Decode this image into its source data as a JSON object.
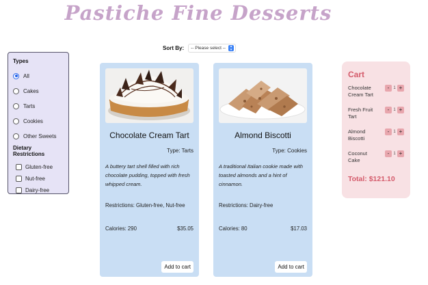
{
  "site": {
    "title": "Pastiche Fine Desserts"
  },
  "sort": {
    "label": "Sort By:",
    "selected": "-- Please select --"
  },
  "filters": {
    "types_heading": "Types",
    "types": [
      "All",
      "Cakes",
      "Tarts",
      "Cookies",
      "Other Sweets"
    ],
    "selected_type": "All",
    "dietary_heading": "Dietary Restrictions",
    "dietary": [
      "Gluten-free",
      "Nut-free",
      "Dairy-free"
    ]
  },
  "products": [
    {
      "name": "Chocolate Cream Tart",
      "type": "Type: Tarts",
      "description": "A buttery tart shell filled with rich chocolate pudding, topped with fresh whipped cream.",
      "restrictions": "Restrictions: Gluten-free, Nut-free",
      "calories": "Calories: 290",
      "price": "$35.05",
      "button": "Add to cart"
    },
    {
      "name": "Almond Biscotti",
      "type": "Type: Cookies",
      "description": "A traditional Italian cookie made with toasted almonds and a hint of cinnamon.",
      "restrictions": "Restrictions: Dairy-free",
      "calories": "Calories: 80",
      "price": "$17.03",
      "button": "Add to cart"
    }
  ],
  "cart": {
    "title": "Cart",
    "items": [
      {
        "name": "Chocolate Cream Tart",
        "qty": "1"
      },
      {
        "name": "Fresh Fruit Tart",
        "qty": "1"
      },
      {
        "name": "Almond Biscotti",
        "qty": "1"
      },
      {
        "name": "Coconut Cake",
        "qty": "1"
      }
    ],
    "minus": "-",
    "plus": "+",
    "total": "Total: $121.10"
  },
  "colors": {
    "title": "#c6a3c9",
    "card_bg": "#c9def4",
    "cart_bg": "#f8e1e4",
    "accent": "#d45b6b",
    "filter_bg": "#e6e3f6"
  }
}
